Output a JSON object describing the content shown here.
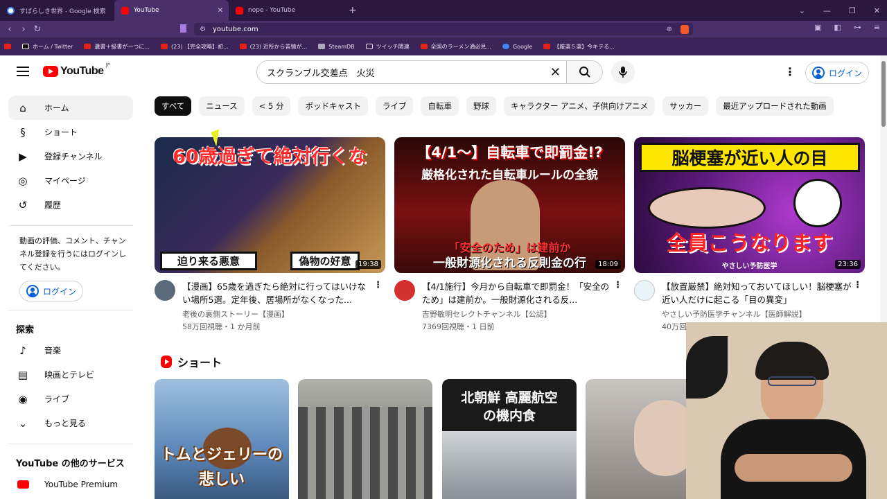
{
  "tabs": [
    {
      "title": "すばらしき世界 - Google 検索",
      "active": false
    },
    {
      "title": "YouTube",
      "active": true
    },
    {
      "title": "nope - YouTube",
      "active": false
    }
  ],
  "address": {
    "url": "youtube.com"
  },
  "bookmarks": [
    "ホーム / Twitter",
    "遺書＋級書が一つに...",
    "(23) 【完全攻略】初...",
    "(23) 近所から苦情が...",
    "SteamDB",
    "ツイッチ関連",
    "全国のラーメン通必見...",
    "Google",
    "【厳選５選】今キテる..."
  ],
  "header": {
    "logo": "YouTube",
    "region": "JP",
    "search_value": "スクランブル交差点　火災",
    "login_label": "ログイン"
  },
  "sidebar": {
    "items": [
      {
        "label": "ホーム",
        "icon": "home-icon"
      },
      {
        "label": "ショート",
        "icon": "shorts-icon"
      },
      {
        "label": "登録チャンネル",
        "icon": "subscriptions-icon"
      },
      {
        "label": "マイページ",
        "icon": "user-icon"
      },
      {
        "label": "履歴",
        "icon": "history-icon"
      }
    ],
    "signin_text": "動画の評価、コメント、チャンネル登録を行うにはログインしてください。",
    "signin_button": "ログイン",
    "explore_title": "探索",
    "explore": [
      {
        "label": "音楽",
        "icon": "music-icon"
      },
      {
        "label": "映画とテレビ",
        "icon": "film-icon"
      },
      {
        "label": "ライブ",
        "icon": "live-icon"
      },
      {
        "label": "もっと見る",
        "icon": "chevron-down-icon"
      }
    ],
    "other_title": "YouTube の他のサービス",
    "other": [
      {
        "label": "YouTube Premium",
        "icon": "youtube-premium-icon"
      }
    ]
  },
  "chips": [
    "すべて",
    "ニュース",
    "< 5 分",
    "ポッドキャスト",
    "ライブ",
    "自転車",
    "野球",
    "キャラクター アニメ、子供向けアニメ",
    "サッカー",
    "最近アップロードされた動画"
  ],
  "videos": [
    {
      "thumb_top": "60歳過ぎて絶対行くな",
      "thumb_bottom_left": "迫り来る悪意",
      "thumb_bottom_right": "偽物の好意",
      "duration": "19:38",
      "title": "【漫画】65歳を過ぎたら絶対に行ってはいけない場所5選。定年後、居場所がなくなった...",
      "channel": "老後の裏側ストーリー【漫画】",
      "stats": "58万回視聴・1 か月前",
      "accent": "#c8102e"
    },
    {
      "thumb_top": "【4/1〜】自転車で即罰金!?",
      "thumb_sub": "厳格化された自転車ルールの全貌",
      "thumb_bottom": "一般財源化される反則金の行",
      "thumb_bottom2": "「安全のため」は建前か",
      "duration": "18:09",
      "title": "【4/1施行】今月から自転車で即罰金！「安全のため」は建前か。一般財源化される反...",
      "channel": "吉野敏明セレクトチャンネル【公認】",
      "stats": "7369回視聴・1 日前",
      "accent": "#7a0a0a"
    },
    {
      "thumb_top": "脳梗塞が近い人の目",
      "thumb_bottom": "全員こうなります",
      "thumb_caption": "やさしい予防医学",
      "duration": "23:36",
      "title": "【放置厳禁】絶対知っておいてほしい！脳梗塞が近い人だけに起こる「目の異変」",
      "channel": "やさしい予防医学チャンネル【医師解説】",
      "stats": "40万回",
      "accent": "#5a1a7a"
    }
  ],
  "shorts": {
    "title": "ショート",
    "items": [
      {
        "text": "トムとジェリーの悲しい",
        "bg": "#5b86b8"
      },
      {
        "text": "",
        "bg": "#8a8a86"
      },
      {
        "text": "北朝鮮 高麗航空の機内食",
        "bg": "#1a1a1a"
      },
      {
        "text": "",
        "bg": "#6f6a66"
      }
    ]
  }
}
